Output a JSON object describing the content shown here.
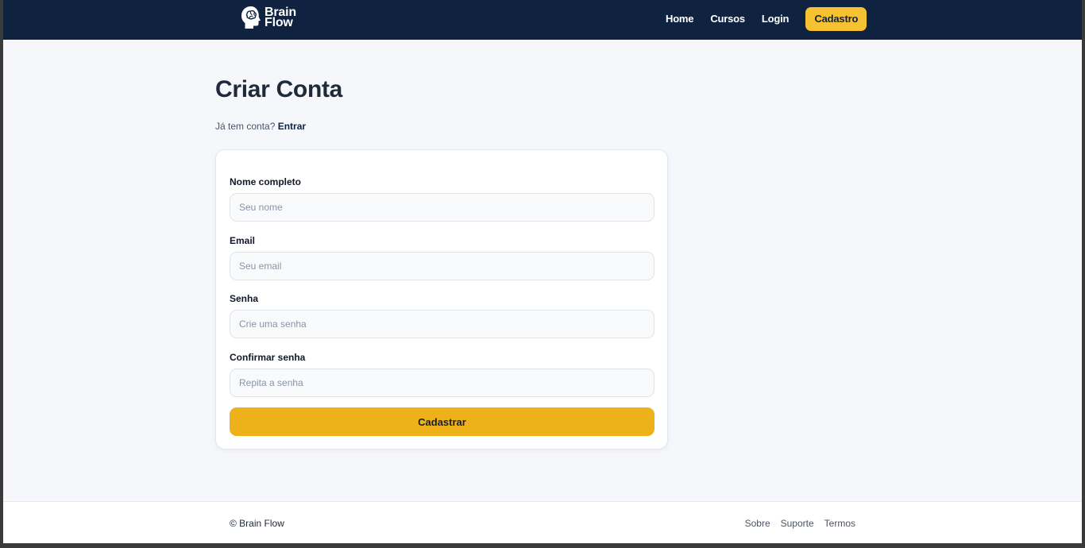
{
  "header": {
    "brand": {
      "line1": "Brain",
      "line2": "Flow",
      "icon": "brain-head-icon"
    },
    "nav": [
      {
        "label": "Home"
      },
      {
        "label": "Cursos"
      },
      {
        "label": "Login"
      }
    ],
    "cta_label": "Cadastro"
  },
  "main": {
    "title": "Criar Conta",
    "login_prompt": "Já tem conta?",
    "login_link": "Entrar",
    "form": {
      "fields": [
        {
          "label": "Nome completo",
          "placeholder": "Seu nome",
          "value": ""
        },
        {
          "label": "Email",
          "placeholder": "Seu email",
          "value": ""
        },
        {
          "label": "Senha",
          "placeholder": "Crie uma senha",
          "value": ""
        },
        {
          "label": "Confirmar senha",
          "placeholder": "Repita a senha",
          "value": ""
        }
      ],
      "submit_label": "Cadastrar"
    }
  },
  "footer": {
    "copyright": "© Brain Flow",
    "links": [
      {
        "label": "Sobre"
      },
      {
        "label": "Suporte"
      },
      {
        "label": "Termos"
      }
    ]
  },
  "colors": {
    "navbar": "#0f2341",
    "accent": "#f6c231",
    "button": "#eeb11a",
    "background": "#f5f7fa"
  }
}
